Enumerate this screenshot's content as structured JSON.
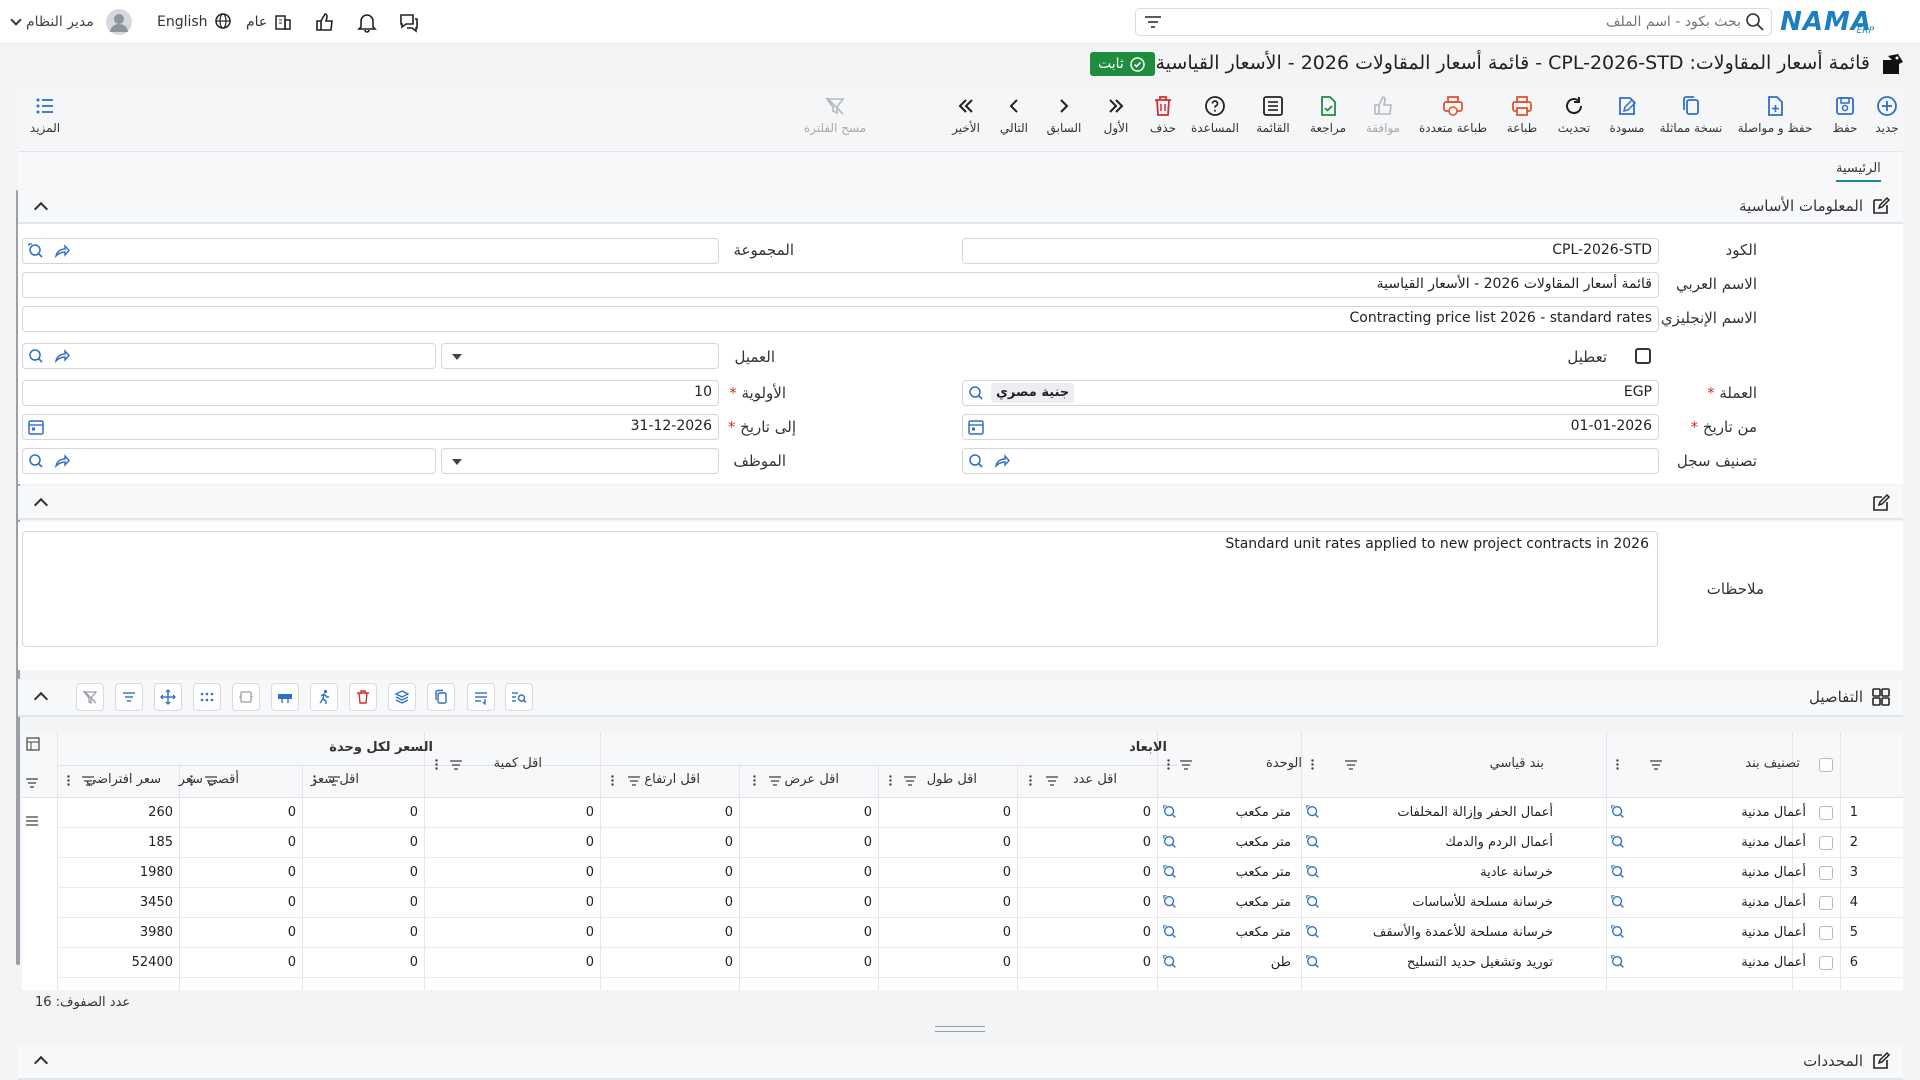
{
  "topbar": {
    "user_name": "مدير النظام",
    "language": "English",
    "scope": "عام",
    "search_placeholder": "بحث بكود - اسم الملف",
    "logo_text": "NAMA",
    "logo_sub": "ERP"
  },
  "page": {
    "title": "قائمة أسعار المقاولات: CPL-2026-STD - قائمة أسعار المقاولات 2026 - الأسعار القياسية",
    "status": "ثابت"
  },
  "toolbar": {
    "items": [
      "جديد",
      "حفظ",
      "حفظ و مواصلة",
      "نسخة مماثلة",
      "مسودة",
      "تحديث",
      "طباعة",
      "طباعة متعددة",
      "موافقة",
      "مراجعة",
      "القائمة",
      "المساعدة",
      "حذف",
      "الأول",
      "السابق",
      "التالي",
      "الأخير",
      "مسح الفلترة"
    ],
    "more": "المزيد"
  },
  "tabs": {
    "main": "الرئيسية"
  },
  "basic_info": {
    "section_title": "المعلومات الأساسية",
    "code_label": "الكود",
    "code_value": "CPL-2026-STD",
    "group_label": "المجموعة",
    "group_value": "",
    "arabic_name_label": "الاسم العربي",
    "arabic_name_value": "قائمة أسعار المقاولات 2026 - الأسعار القياسية",
    "english_name_label": "الاسم الإنجليزي",
    "english_name_value": "Contracting price list 2026 - standard rates",
    "disable_label": "تعطيل",
    "customer_label": "العميل",
    "currency_label": "العملة",
    "currency_value": "EGP",
    "currency_name": "جنية مصري",
    "priority_label": "الأولوية",
    "priority_value": "10",
    "from_date_label": "من تاريخ",
    "from_date_value": "01-01-2026",
    "to_date_label": "إلى تاريخ",
    "to_date_value": "31-12-2026",
    "record_class_label": "تصنيف سجل",
    "employee_label": "الموظف"
  },
  "notes": {
    "label": "ملاحظات",
    "value": "Standard unit rates applied to new project contracts in 2026"
  },
  "details": {
    "section_title": "التفاصيل",
    "headers": {
      "item_class": "تصنيف بند",
      "std_item": "بند قياسي",
      "unit": "الوحدة",
      "dimensions": "الابعاد",
      "min_count": "اقل عدد",
      "min_length": "اقل طول",
      "min_width": "اقل عرض",
      "min_height": "اقل ارتفاع",
      "min_qty": "اقل كمية",
      "unit_price": "السعر لكل وحدة",
      "min_price": "اقل سعر",
      "max_price": "أقصى سعر",
      "default_price": "سعر افتراضي"
    },
    "rows": [
      {
        "n": "1",
        "cls": "أعمال مدنية",
        "item": "أعمال الحفر وإزالة المخلفات",
        "unit": "متر مكعب",
        "c": "0",
        "l": "0",
        "w": "0",
        "h": "0",
        "q": "0",
        "minp": "0",
        "maxp": "0",
        "def": "260"
      },
      {
        "n": "2",
        "cls": "أعمال مدنية",
        "item": "أعمال الردم والدمك",
        "unit": "متر مكعب",
        "c": "0",
        "l": "0",
        "w": "0",
        "h": "0",
        "q": "0",
        "minp": "0",
        "maxp": "0",
        "def": "185"
      },
      {
        "n": "3",
        "cls": "أعمال مدنية",
        "item": "خرسانة عادية",
        "unit": "متر مكعب",
        "c": "0",
        "l": "0",
        "w": "0",
        "h": "0",
        "q": "0",
        "minp": "0",
        "maxp": "0",
        "def": "1980"
      },
      {
        "n": "4",
        "cls": "أعمال مدنية",
        "item": "خرسانة مسلحة للأساسات",
        "unit": "متر مكعب",
        "c": "0",
        "l": "0",
        "w": "0",
        "h": "0",
        "q": "0",
        "minp": "0",
        "maxp": "0",
        "def": "3450"
      },
      {
        "n": "5",
        "cls": "أعمال مدنية",
        "item": "خرسانة مسلحة للأعمدة والأسقف",
        "unit": "متر مكعب",
        "c": "0",
        "l": "0",
        "w": "0",
        "h": "0",
        "q": "0",
        "minp": "0",
        "maxp": "0",
        "def": "3980"
      },
      {
        "n": "6",
        "cls": "أعمال مدنية",
        "item": "توريد وتشغيل حديد التسليح",
        "unit": "طن",
        "c": "0",
        "l": "0",
        "w": "0",
        "h": "0",
        "q": "0",
        "minp": "0",
        "maxp": "0",
        "def": "52400"
      }
    ],
    "row_count_label": "عدد الصفوف: 16"
  },
  "footer": {
    "section_title": "المحددات"
  },
  "colors": {
    "accent": "#1a8a9a",
    "icon_blue": "#2f6fc6",
    "danger": "#d32f2f",
    "success": "#1e8e3e",
    "print": "#e0542e"
  }
}
